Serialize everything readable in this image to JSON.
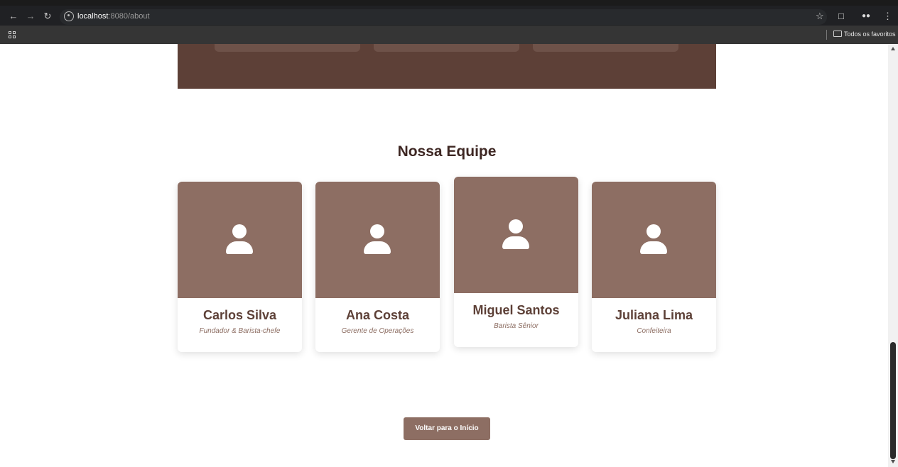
{
  "browser": {
    "url_host": "localhost",
    "url_path": ":8080/about",
    "bookmarks_label": "Todos os favoritos"
  },
  "team": {
    "title": "Nossa Equipe",
    "members": [
      {
        "name": "Carlos Silva",
        "role": "Fundador & Barista-chefe"
      },
      {
        "name": "Ana Costa",
        "role": "Gerente de Operações"
      },
      {
        "name": "Miguel Santos",
        "role": "Barista Sênior"
      },
      {
        "name": "Juliana Lima",
        "role": "Confeiteira"
      }
    ]
  },
  "back_button": {
    "label": "Voltar para o Início"
  },
  "colors": {
    "primary_dark": "#5d4037",
    "primary": "#8d6e63",
    "heading": "#3e2723"
  }
}
